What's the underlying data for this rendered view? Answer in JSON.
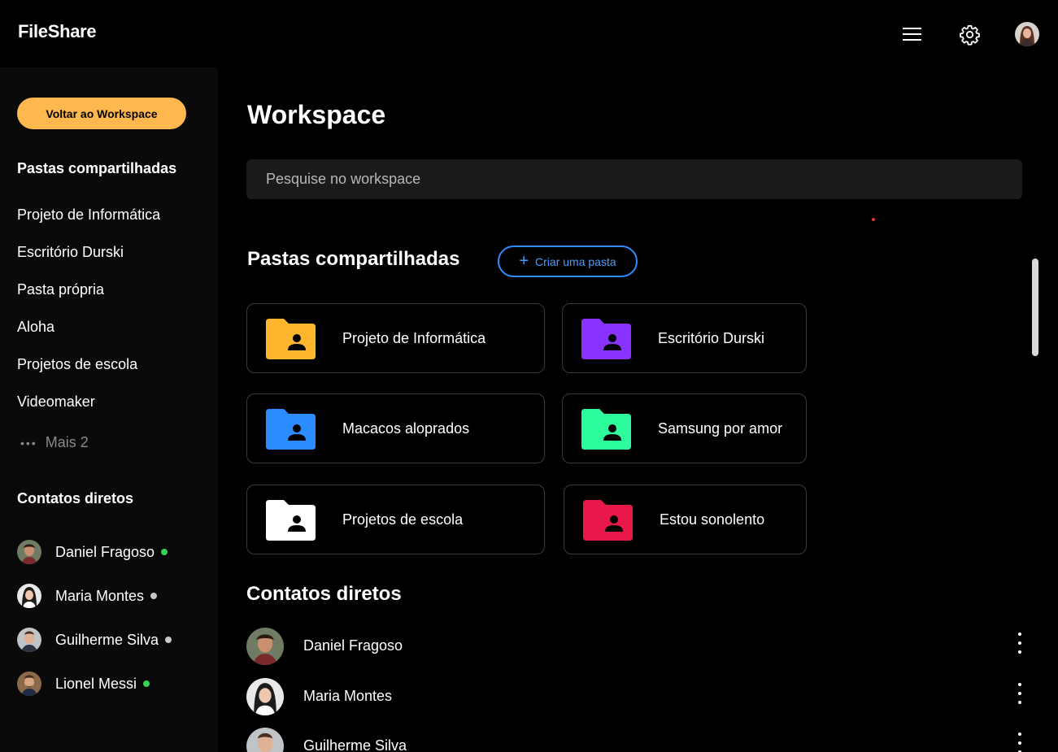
{
  "app": {
    "title": "FileShare"
  },
  "header": {
    "icons": [
      "menu-icon",
      "gear-icon",
      "user-avatar"
    ]
  },
  "sidebar": {
    "back_button": "Voltar ao Workspace",
    "folders_heading": "Pastas compartilhadas",
    "folders": [
      "Projeto de Informática",
      "Escritório Durski",
      "Pasta própria",
      "Aloha",
      "Projetos de escola",
      "Videomaker"
    ],
    "more": {
      "icon": "ellipsis-icon",
      "label": "Mais 2"
    },
    "contacts_heading": "Contatos diretos",
    "contacts": [
      {
        "name": "Daniel Fragoso",
        "status": "online",
        "status_color": "#39d353"
      },
      {
        "name": "Maria Montes",
        "status": "offline",
        "status_color": "#c8c8c8"
      },
      {
        "name": "Guilherme Silva",
        "status": "offline",
        "status_color": "#c8c8c8"
      },
      {
        "name": "Lionel Messi",
        "status": "online",
        "status_color": "#39d353"
      }
    ]
  },
  "main": {
    "title": "Workspace",
    "search": {
      "placeholder": "Pesquise no workspace"
    },
    "folders_section": {
      "title": "Pastas compartilhadas",
      "create_button": "Criar uma pasta",
      "cards": [
        {
          "name": "Projeto de Informática",
          "color": "#ffb52e"
        },
        {
          "name": "Escritório Durski",
          "color": "#8833ff"
        },
        {
          "name": "Macacos aloprados",
          "color": "#2a8cff"
        },
        {
          "name": "Samsung por amor",
          "color": "#2dfc9c"
        },
        {
          "name": "Projetos de escola",
          "color": "#ffffff"
        },
        {
          "name": "Estou sonolento",
          "color": "#e8184b"
        }
      ]
    },
    "contacts_section": {
      "title": "Contatos diretos",
      "contacts": [
        {
          "name": "Daniel Fragoso"
        },
        {
          "name": "Maria Montes"
        },
        {
          "name": "Guilherme Silva"
        }
      ]
    }
  },
  "colors": {
    "accent_orange": "#ffb84d",
    "accent_blue": "#2f8cff",
    "background": "#000000",
    "sidebar": "#0a0a0a"
  }
}
